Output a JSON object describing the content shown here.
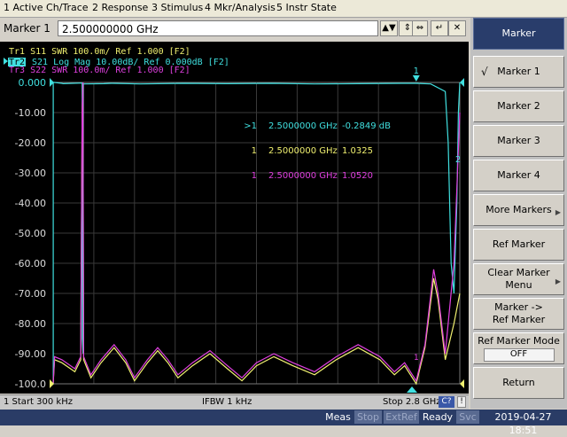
{
  "menu": [
    "1 Active Ch/Trace",
    "2 Response",
    "3 Stimulus",
    "4 Mkr/Analysis",
    "5 Instr State"
  ],
  "entry": {
    "label": "Marker 1",
    "value": "2.500000000 GHz",
    "buttons": [
      "▲▼",
      "⇕",
      "⇔",
      "↵",
      "✕"
    ]
  },
  "traces": [
    {
      "id": "Tr1",
      "text": "Tr1  S11  SWR 100.0m/ Ref 1.000 [F2]",
      "color": "#f0f070"
    },
    {
      "id": "Tr2",
      "text": "S21  Log Mag 10.00dB/ Ref 0.000dB [F2]",
      "color": "#40e0e0"
    },
    {
      "id": "Tr3",
      "text": "Tr3  S22  SWR 100.0m/ Ref 1.000 [F2]",
      "color": "#e040e0"
    }
  ],
  "active_trace_tag": "Tr2",
  "markers": [
    {
      "prefix": ">1",
      "freq": "2.5000000 GHz",
      "value": "-0.2849 dB",
      "color": "#40e0e0"
    },
    {
      "prefix": "1",
      "freq": "2.5000000 GHz",
      "value": "1.0325",
      "color": "#f0f070"
    },
    {
      "prefix": "1",
      "freq": "2.5000000 GHz",
      "value": "1.0520",
      "color": "#e040e0"
    }
  ],
  "marker_flags": [
    "1",
    "2"
  ],
  "chart_data": {
    "type": "line",
    "y_ticks": [
      "0.000",
      "-10.00",
      "-20.00",
      "-30.00",
      "-40.00",
      "-50.00",
      "-60.00",
      "-70.00",
      "-80.00",
      "-90.00",
      "-100.0"
    ],
    "ylim": [
      -100,
      0
    ],
    "xlim_hz": [
      300000,
      2800000000
    ],
    "grid": true,
    "series": [
      {
        "color": "#40e0e0",
        "points": [
          [
            0.3,
            -100
          ],
          [
            0.99,
            -100
          ],
          [
            1.0,
            0
          ],
          [
            10,
            0
          ],
          [
            60,
            -0.3
          ],
          [
            70,
            -0.4
          ],
          [
            200,
            -0.2
          ],
          [
            201,
            -85
          ],
          [
            206,
            -90
          ],
          [
            208,
            -0.4
          ],
          [
            211,
            -0.5
          ],
          [
            350,
            -0.4
          ],
          [
            400,
            -0.3
          ],
          [
            600,
            -0.5
          ],
          [
            900,
            -0.3
          ],
          [
            1200,
            -0.4
          ],
          [
            1500,
            -0.3
          ],
          [
            1800,
            -0.5
          ],
          [
            2100,
            -0.4
          ],
          [
            2400,
            -0.3
          ],
          [
            2500,
            -0.2849
          ],
          [
            2600,
            -0.5
          ],
          [
            2700,
            -3
          ],
          [
            2720,
            -20
          ],
          [
            2740,
            -60
          ],
          [
            2760,
            -70
          ],
          [
            2780,
            -40
          ],
          [
            2790,
            -10
          ],
          [
            2800,
            0
          ]
        ]
      },
      {
        "color": "#f0f070",
        "points": [
          [
            0.3,
            -100
          ],
          [
            10,
            -92
          ],
          [
            60,
            -93
          ],
          [
            150,
            -96
          ],
          [
            190,
            -92
          ],
          [
            200,
            -10
          ],
          [
            205,
            0
          ],
          [
            210,
            -92
          ],
          [
            260,
            -98
          ],
          [
            330,
            -93
          ],
          [
            420,
            -88
          ],
          [
            500,
            -93
          ],
          [
            560,
            -99
          ],
          [
            650,
            -93
          ],
          [
            720,
            -89
          ],
          [
            790,
            -93
          ],
          [
            860,
            -98
          ],
          [
            960,
            -94
          ],
          [
            1080,
            -90
          ],
          [
            1200,
            -95
          ],
          [
            1300,
            -99
          ],
          [
            1400,
            -94
          ],
          [
            1520,
            -91
          ],
          [
            1650,
            -94
          ],
          [
            1800,
            -97
          ],
          [
            1950,
            -92
          ],
          [
            2100,
            -88
          ],
          [
            2250,
            -92
          ],
          [
            2350,
            -97
          ],
          [
            2420,
            -94
          ],
          [
            2500,
            -100
          ],
          [
            2560,
            -88
          ],
          [
            2620,
            -65
          ],
          [
            2650,
            -72
          ],
          [
            2700,
            -92
          ],
          [
            2760,
            -80
          ],
          [
            2800,
            -70
          ]
        ]
      },
      {
        "color": "#e040e0",
        "points": [
          [
            0.3,
            -100
          ],
          [
            10,
            -91
          ],
          [
            60,
            -92
          ],
          [
            150,
            -95
          ],
          [
            190,
            -91
          ],
          [
            200,
            -10
          ],
          [
            205,
            0
          ],
          [
            210,
            -91
          ],
          [
            260,
            -97
          ],
          [
            330,
            -92
          ],
          [
            420,
            -87
          ],
          [
            500,
            -92
          ],
          [
            560,
            -98
          ],
          [
            650,
            -92
          ],
          [
            720,
            -88
          ],
          [
            790,
            -92
          ],
          [
            860,
            -97
          ],
          [
            960,
            -93
          ],
          [
            1080,
            -89
          ],
          [
            1200,
            -94
          ],
          [
            1300,
            -98
          ],
          [
            1400,
            -93
          ],
          [
            1520,
            -90
          ],
          [
            1650,
            -93
          ],
          [
            1800,
            -96
          ],
          [
            1950,
            -91
          ],
          [
            2100,
            -87
          ],
          [
            2250,
            -91
          ],
          [
            2350,
            -96
          ],
          [
            2420,
            -93
          ],
          [
            2500,
            -99
          ],
          [
            2560,
            -87
          ],
          [
            2620,
            -62
          ],
          [
            2650,
            -70
          ],
          [
            2700,
            -90
          ],
          [
            2760,
            -60
          ],
          [
            2800,
            -10
          ]
        ]
      }
    ]
  },
  "softkeys": [
    {
      "label": "Marker",
      "style": "title"
    },
    {
      "label": "Marker 1",
      "check": "√"
    },
    {
      "label": "Marker 2"
    },
    {
      "label": "Marker 3"
    },
    {
      "label": "Marker 4"
    },
    {
      "label": "More Markers",
      "arrow": "▶"
    },
    {
      "label": "Ref Marker"
    },
    {
      "label": "Clear Marker\nMenu",
      "arrow": "▶"
    },
    {
      "label": "Marker ->\nRef Marker"
    },
    {
      "label": "Ref Marker Mode",
      "sub": "OFF"
    },
    {
      "label": "Return"
    }
  ],
  "status": {
    "start": "1  Start 300 kHz",
    "ifbw": "IFBW 1 kHz",
    "stop": "Stop 2.8 GHz",
    "cal": "C?",
    "excl": "!"
  },
  "instr_status": {
    "meas": "Meas",
    "stop": "Stop",
    "extref": "ExtRef",
    "ready": "Ready",
    "svc": "Svc",
    "datetime": "2019-04-27 18:51"
  }
}
